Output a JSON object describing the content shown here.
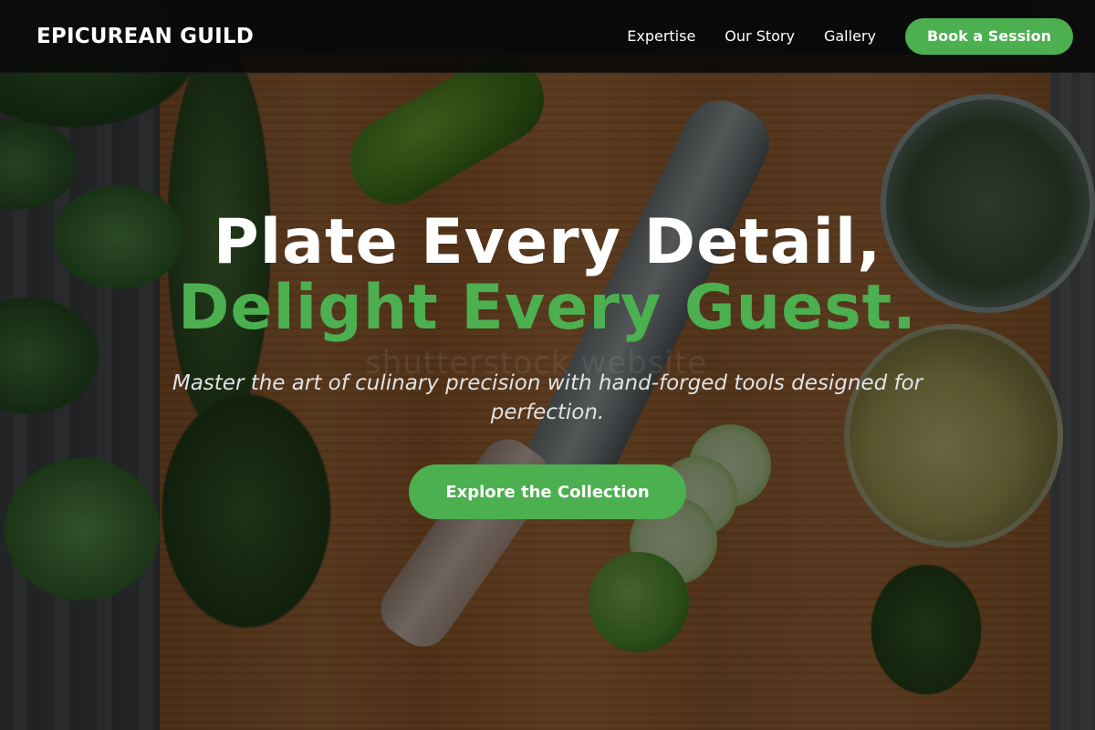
{
  "header": {
    "logo": "EPICUREAN GUILD",
    "nav": [
      {
        "label": "Expertise"
      },
      {
        "label": "Our Story"
      },
      {
        "label": "Gallery"
      }
    ],
    "cta_label": "Book a Session"
  },
  "hero": {
    "headline_line1": "Plate Every Detail,",
    "headline_line2": "Delight Every Guest.",
    "subtitle": "Master the art of culinary precision with hand-forged tools designed for perfection.",
    "cta_label": "Explore the Collection",
    "background_image": "kitchen-board-knife-herbs-cucumber",
    "watermark": "shutterstock website"
  },
  "colors": {
    "accent": "#4caf50",
    "header_bg": "#080808",
    "text": "#ffffff",
    "subtitle": "#e2e2e2"
  }
}
